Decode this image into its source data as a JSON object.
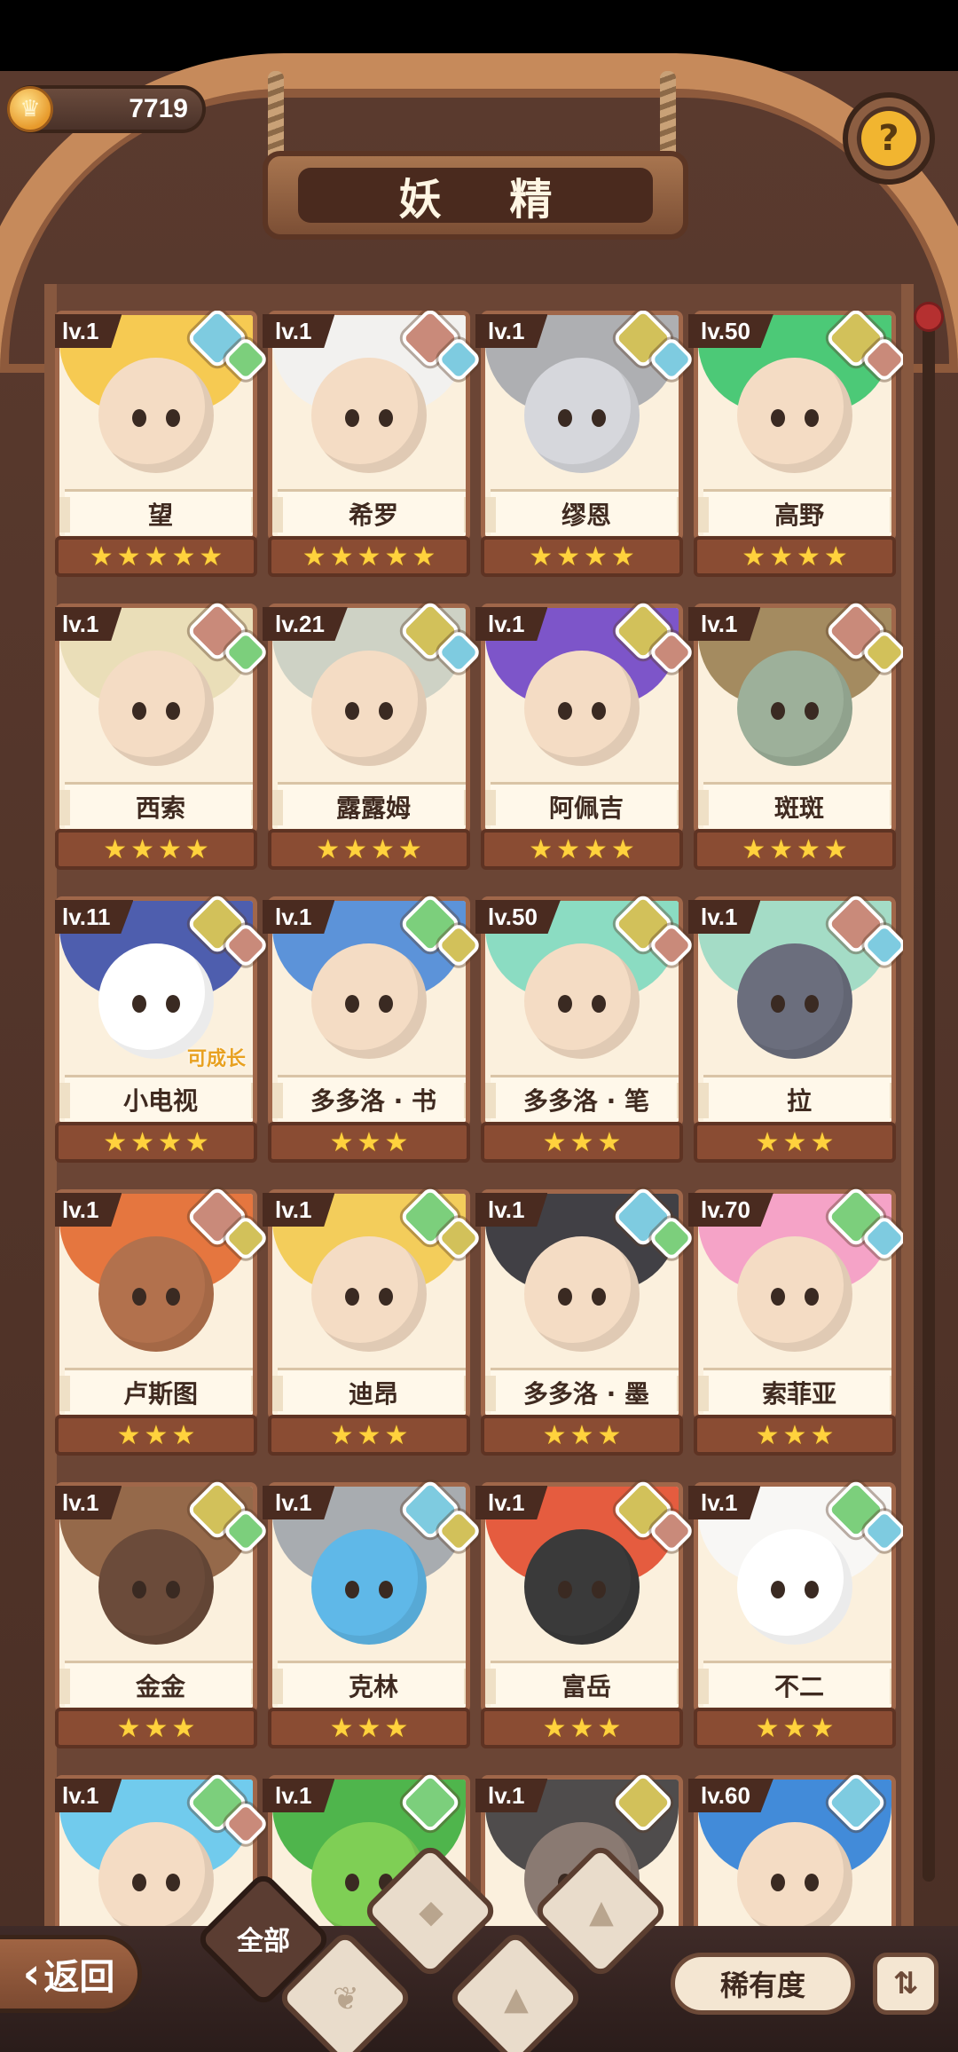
{
  "header": {
    "currency_value": "7719",
    "title": "妖 精",
    "help_icon": "question-mark-icon"
  },
  "cards": [
    {
      "level": "lv.1",
      "name": "望",
      "stars": 5,
      "elements": [
        "water",
        "grass"
      ],
      "palette": [
        "#f5c542",
        "#f4dcc4"
      ]
    },
    {
      "level": "lv.1",
      "name": "希罗",
      "stars": 5,
      "elements": [
        "fire",
        "water"
      ],
      "palette": [
        "#f1f1f1",
        "#f4dcc4"
      ]
    },
    {
      "level": "lv.1",
      "name": "缪恩",
      "stars": 4,
      "elements": [
        "earth",
        "water"
      ],
      "palette": [
        "#a5a7ad",
        "#d6d7dc"
      ]
    },
    {
      "level": "lv.50",
      "name": "高野",
      "stars": 4,
      "elements": [
        "earth",
        "fire"
      ],
      "palette": [
        "#39c46b",
        "#f4dcc4"
      ]
    },
    {
      "level": "lv.1",
      "name": "西索",
      "stars": 4,
      "elements": [
        "fire",
        "grass"
      ],
      "palette": [
        "#e8dcb4",
        "#f4dcc4"
      ]
    },
    {
      "level": "lv.21",
      "name": "露露姆",
      "stars": 4,
      "elements": [
        "earth",
        "water"
      ],
      "palette": [
        "#c9cec2",
        "#f4dcc4"
      ]
    },
    {
      "level": "lv.1",
      "name": "阿佩吉",
      "stars": 4,
      "elements": [
        "earth",
        "fire"
      ],
      "palette": [
        "#6f44c7",
        "#f4dcc4"
      ]
    },
    {
      "level": "lv.1",
      "name": "斑斑",
      "stars": 4,
      "elements": [
        "fire",
        "earth"
      ],
      "palette": [
        "#9a7f52",
        "#9db09a"
      ]
    },
    {
      "level": "lv.11",
      "name": "小电视",
      "stars": 4,
      "elements": [
        "earth",
        "fire"
      ],
      "palette": [
        "#3b4ea8",
        "#ffffff"
      ],
      "badge": "可成长"
    },
    {
      "level": "lv.1",
      "name": "多多洛 · 书",
      "stars": 3,
      "elements": [
        "grass",
        "earth"
      ],
      "palette": [
        "#4a88d8",
        "#f4dcc4"
      ]
    },
    {
      "level": "lv.50",
      "name": "多多洛 · 笔",
      "stars": 3,
      "elements": [
        "earth",
        "fire"
      ],
      "palette": [
        "#7ed9bf",
        "#f4dcc4"
      ]
    },
    {
      "level": "lv.1",
      "name": "拉",
      "stars": 3,
      "elements": [
        "fire",
        "water"
      ],
      "palette": [
        "#9ad9c3",
        "#6b6e7d"
      ]
    },
    {
      "level": "lv.1",
      "name": "卢斯图",
      "stars": 3,
      "elements": [
        "fire",
        "earth"
      ],
      "palette": [
        "#e2682d",
        "#b2714d"
      ]
    },
    {
      "level": "lv.1",
      "name": "迪昂",
      "stars": 3,
      "elements": [
        "grass",
        "earth"
      ],
      "palette": [
        "#f2c94c",
        "#f4dcc4"
      ]
    },
    {
      "level": "lv.1",
      "name": "多多洛 · 墨",
      "stars": 3,
      "elements": [
        "water",
        "grass"
      ],
      "palette": [
        "#2c2c34",
        "#f4dcc4"
      ]
    },
    {
      "level": "lv.70",
      "name": "索菲亚",
      "stars": 3,
      "elements": [
        "grass",
        "water"
      ],
      "palette": [
        "#f49ac4",
        "#f4dcc4"
      ]
    },
    {
      "level": "lv.1",
      "name": "金金",
      "stars": 3,
      "elements": [
        "earth",
        "grass"
      ],
      "palette": [
        "#8a5a3a",
        "#6b4b3a"
      ]
    },
    {
      "level": "lv.1",
      "name": "克林",
      "stars": 3,
      "elements": [
        "water",
        "earth"
      ],
      "palette": [
        "#9fa4ab",
        "#5fb8e8"
      ]
    },
    {
      "level": "lv.1",
      "name": "富岳",
      "stars": 3,
      "elements": [
        "earth",
        "fire"
      ],
      "palette": [
        "#e24b2e",
        "#3a3a3a"
      ]
    },
    {
      "level": "lv.1",
      "name": "不二",
      "stars": 3,
      "elements": [
        "grass",
        "water"
      ],
      "palette": [
        "#f7f7f7",
        "#ffffff"
      ]
    },
    {
      "level": "lv.1",
      "name": "",
      "stars": 0,
      "elements": [
        "grass",
        "fire"
      ],
      "palette": [
        "#62c7ee",
        "#f4dcc4"
      ]
    },
    {
      "level": "lv.1",
      "name": "",
      "stars": 0,
      "elements": [
        "grass"
      ],
      "palette": [
        "#3cae3c",
        "#7fcf55"
      ]
    },
    {
      "level": "lv.1",
      "name": "",
      "stars": 0,
      "elements": [
        "earth"
      ],
      "palette": [
        "#3c3a3c",
        "#8a7a72"
      ]
    },
    {
      "level": "lv.60",
      "name": "",
      "stars": 0,
      "elements": [
        "water"
      ],
      "palette": [
        "#2e7fd8",
        "#f4dcc4"
      ]
    }
  ],
  "element_colors": {
    "water": "#7ecbe0",
    "grass": "#7ccf7c",
    "earth": "#d2c15a",
    "fire": "#c98a7a"
  },
  "bottom": {
    "back_label": "返回",
    "filter_all_label": "全部",
    "sort_label": "稀有度",
    "order_icon": "sort-order-icon"
  }
}
